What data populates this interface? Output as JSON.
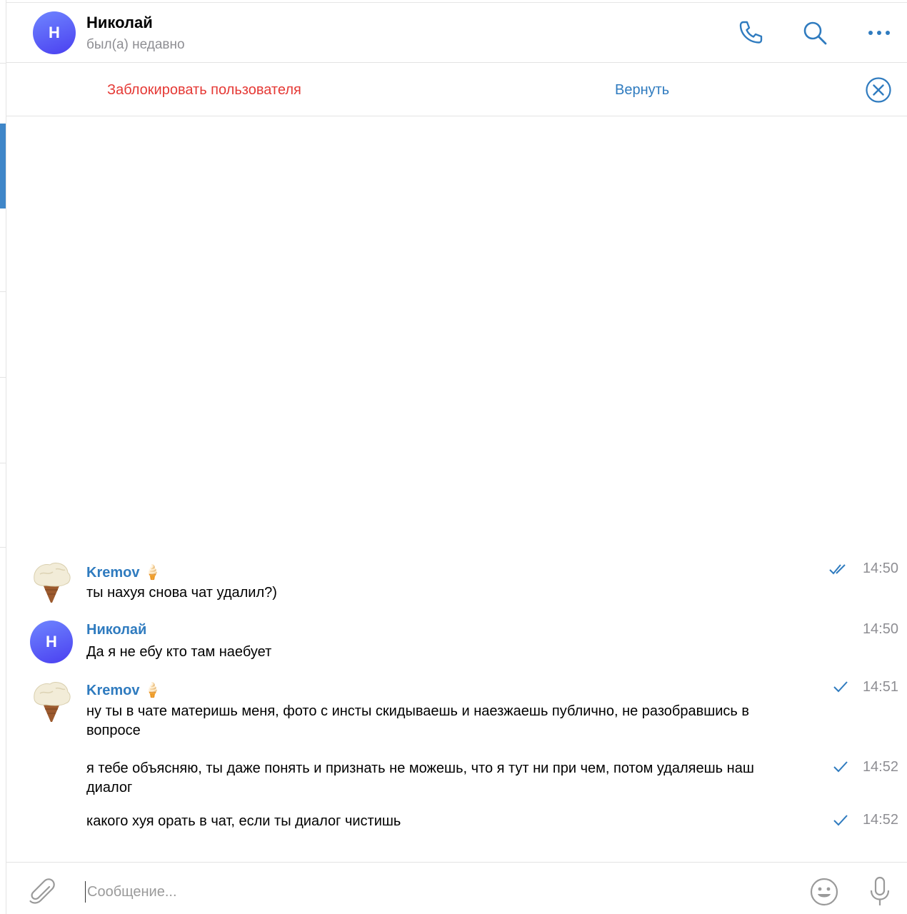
{
  "header": {
    "avatar_letter": "Н",
    "name": "Николай",
    "status": "был(а) недавно",
    "icons": [
      "phone-icon",
      "search-icon",
      "more-icon"
    ]
  },
  "notice": {
    "block_label": "Заблокировать пользователя",
    "undo_label": "Вернуть",
    "close_icon": "close-circle-icon"
  },
  "messages": [
    {
      "author": "Kremov 🍦",
      "avatar": "ice-cream-avatar",
      "text": "ты нахуя снова чат удалил?)",
      "time": "14:50",
      "status": "read"
    },
    {
      "author": "Николай",
      "avatar_letter": "Н",
      "text": "Да я не ебу кто там наебует",
      "time": "14:50",
      "status": "none"
    },
    {
      "author": "Kremov 🍦",
      "avatar": "ice-cream-avatar",
      "text": "ну ты в чате материшь меня, фото с инсты скидываешь и наезжаешь публично, не разобравшись в вопросе",
      "time": "14:51",
      "status": "sent"
    },
    {
      "author": "",
      "text": "я тебе объясняю, ты даже понять и признать не можешь, что я тут ни при чем, потом удаляешь наш диалог",
      "time": "14:52",
      "status": "sent"
    },
    {
      "author": "",
      "text": "какого хуя орать в чат, если ты диалог чистишь",
      "time": "14:52",
      "status": "sent"
    }
  ],
  "composer": {
    "placeholder": "Сообщение...",
    "value": "",
    "icons": [
      "attach-icon",
      "emoji-icon",
      "microphone-icon"
    ]
  },
  "colors": {
    "accent": "#2f7bbf",
    "danger": "#e53935",
    "avatar_gradient": [
      "#6f86ff",
      "#4a3ff0"
    ],
    "muted": "#8e8e93"
  }
}
